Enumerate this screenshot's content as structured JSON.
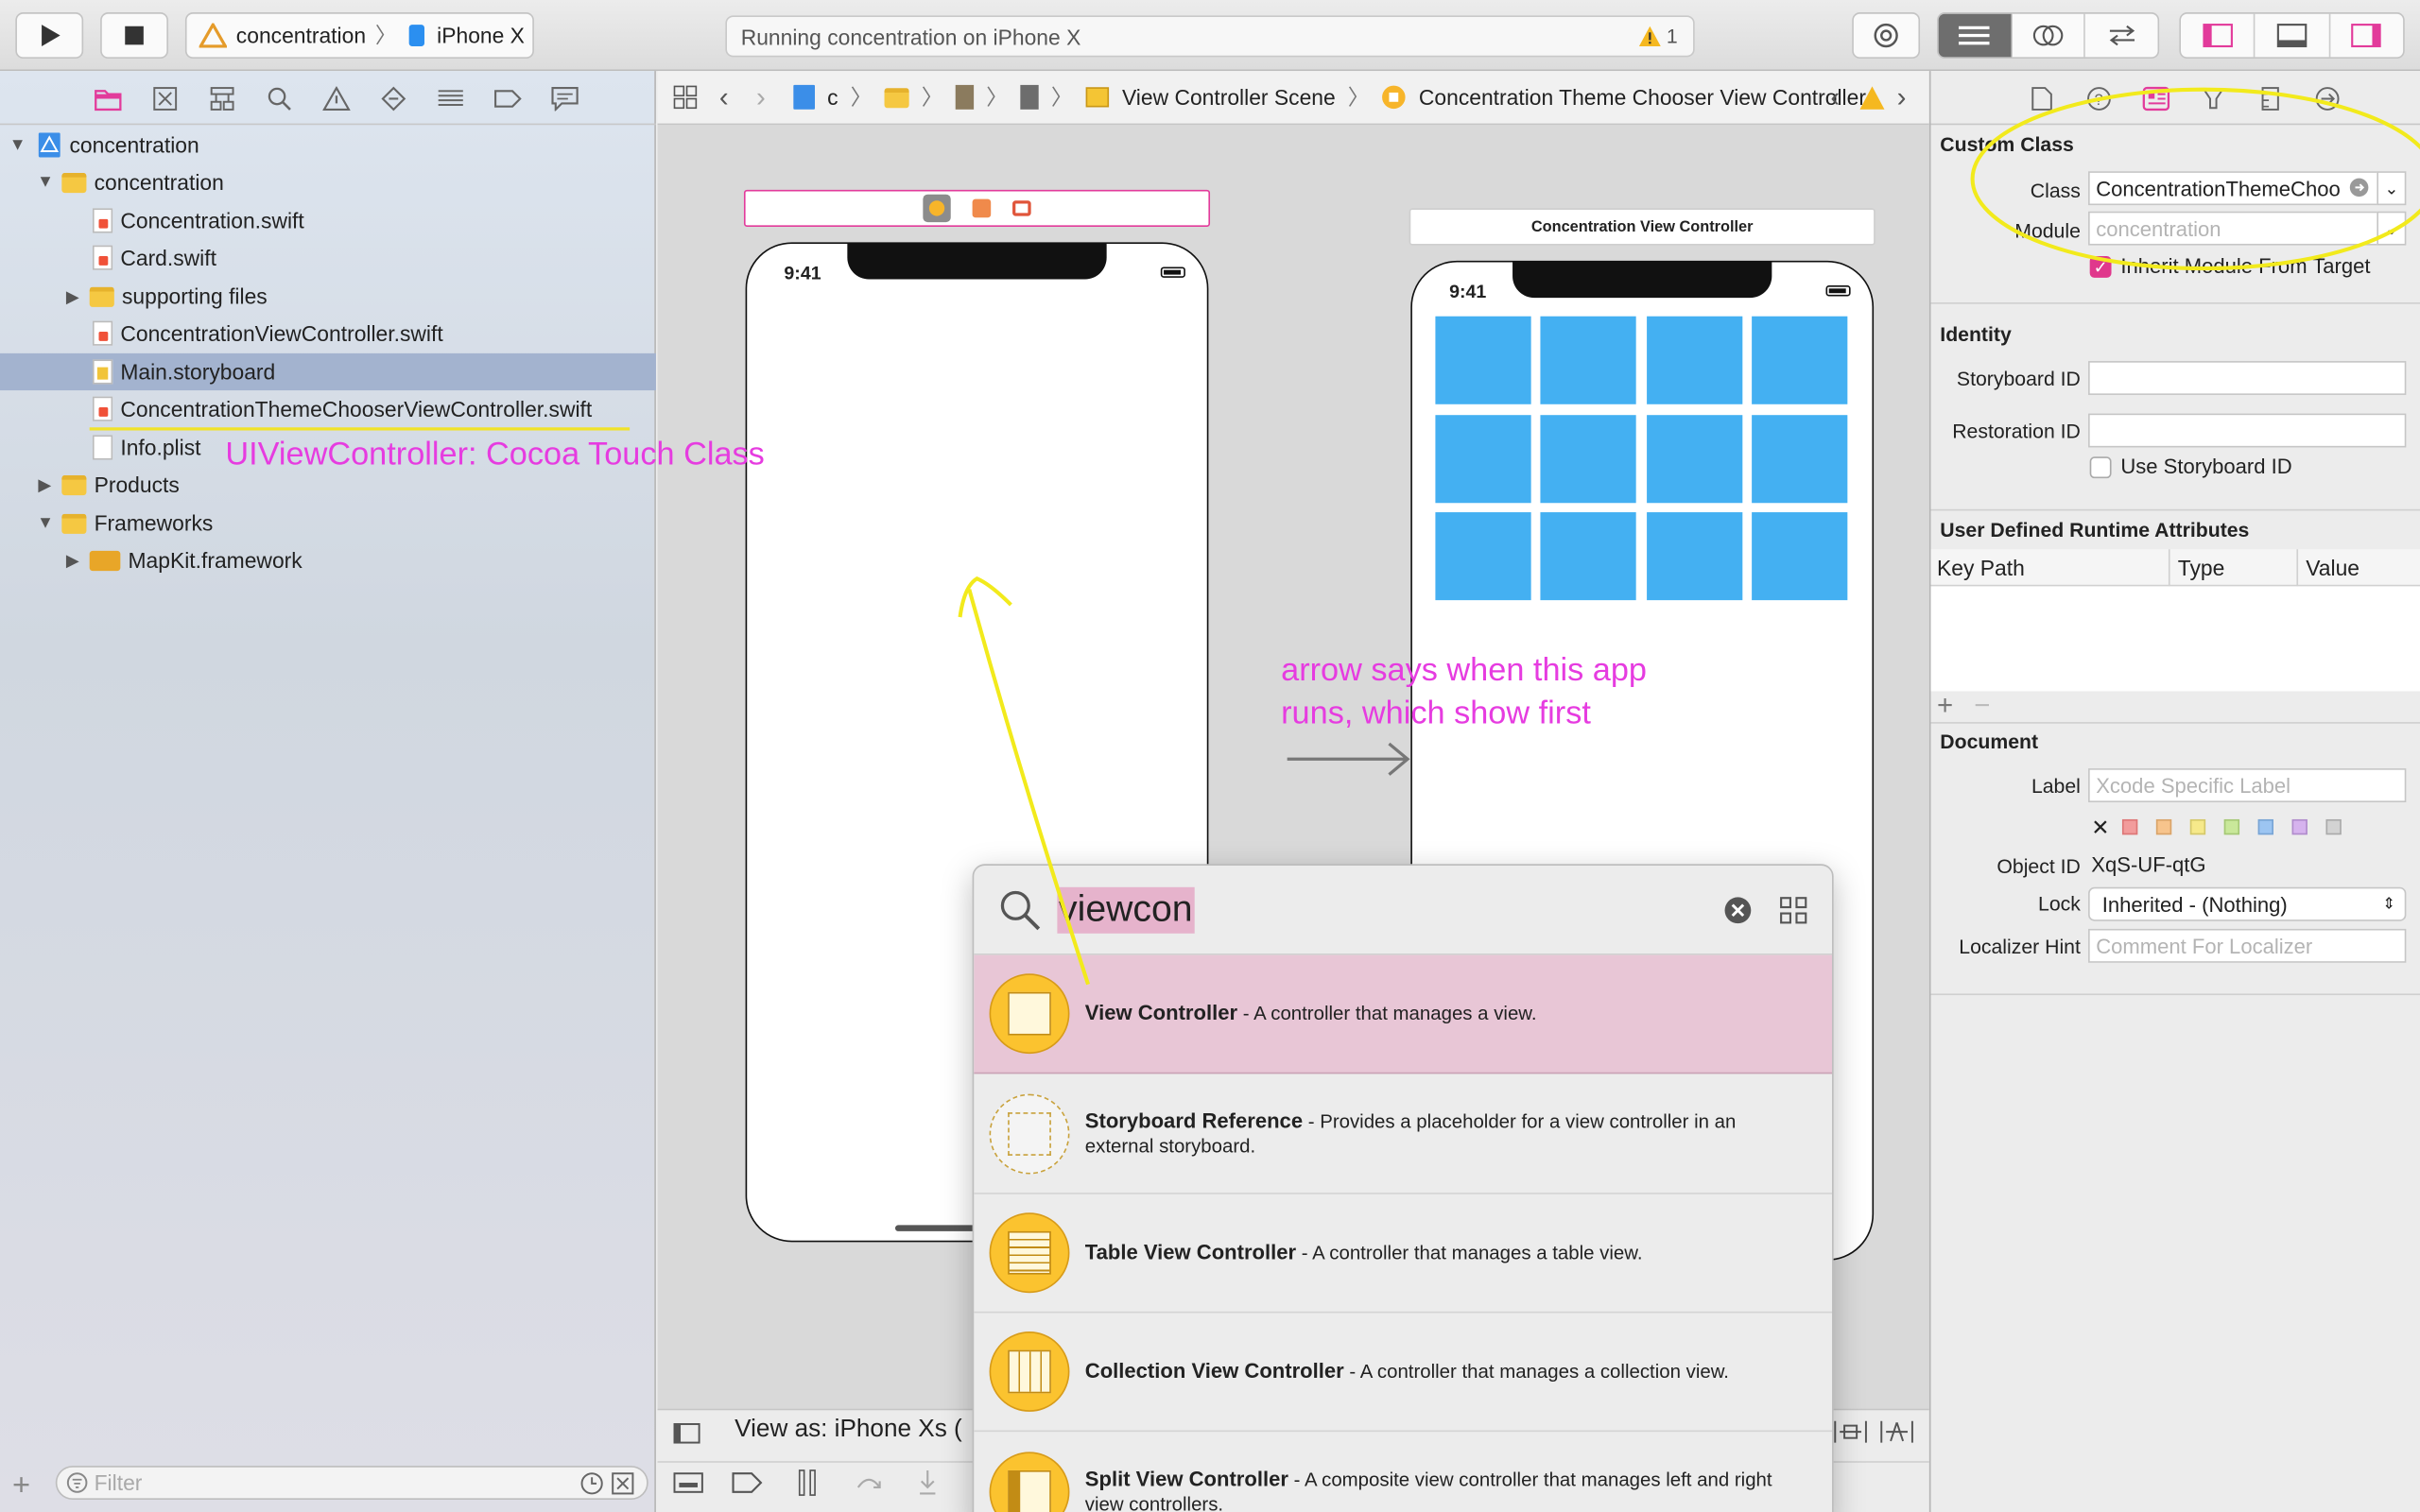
{
  "toolbar": {
    "scheme_target": "concentration",
    "scheme_device": "iPhone X",
    "status_text": "Running concentration on iPhone X",
    "warning_count": "1"
  },
  "navigator": {
    "project": "concentration",
    "group": "concentration",
    "files": [
      "Concentration.swift",
      "Card.swift",
      "supporting files",
      "ConcentrationViewController.swift",
      "Main.storyboard",
      "ConcentrationThemeChooserViewController.swift",
      "Info.plist"
    ],
    "products": "Products",
    "frameworks": "Frameworks",
    "mapkit": "MapKit.framework",
    "filter_placeholder": "Filter"
  },
  "jumpbar": {
    "c": "c",
    "scene": "View Controller Scene",
    "controller": "Concentration Theme Chooser View Controller"
  },
  "canvas": {
    "left_clock": "9:41",
    "right_title": "Concentration View Controller",
    "right_clock": "9:41",
    "view_as": "View as: iPhone Xs ("
  },
  "library": {
    "query": "viewcon",
    "items": [
      {
        "title": "View Controller",
        "desc": " - A controller that manages a view."
      },
      {
        "title": "Storyboard Reference",
        "desc": " - Provides a placeholder for a view controller in an external storyboard."
      },
      {
        "title": "Table View Controller",
        "desc": " - A controller that manages a table view."
      },
      {
        "title": "Collection View Controller",
        "desc": " - A controller that manages a collection view."
      },
      {
        "title": "Split View Controller",
        "desc": " - A composite view controller that manages left and right view controllers."
      }
    ]
  },
  "inspector": {
    "custom_class_header": "Custom Class",
    "class_label": "Class",
    "class_value": "ConcentrationThemeChoo",
    "module_label": "Module",
    "module_placeholder": "concentration",
    "inherit_label": "Inherit Module From Target",
    "identity_header": "Identity",
    "storyboard_id_label": "Storyboard ID",
    "restoration_id_label": "Restoration ID",
    "use_storyboard_id": "Use Storyboard ID",
    "udra_header": "User Defined Runtime Attributes",
    "col_key_path": "Key Path",
    "col_type": "Type",
    "col_value": "Value",
    "document_header": "Document",
    "label_label": "Label",
    "label_placeholder": "Xcode Specific Label",
    "object_id_label": "Object ID",
    "object_id_value": "XqS-UF-qtG",
    "lock_label": "Lock",
    "lock_value": "Inherited - (Nothing)",
    "localizer_label": "Localizer Hint",
    "localizer_placeholder": "Comment For Localizer"
  },
  "annotations": {
    "note1": "UIViewController: Cocoa Touch Class",
    "note2_line1": "arrow says when this app",
    "note2_line2": "runs, which show first"
  }
}
